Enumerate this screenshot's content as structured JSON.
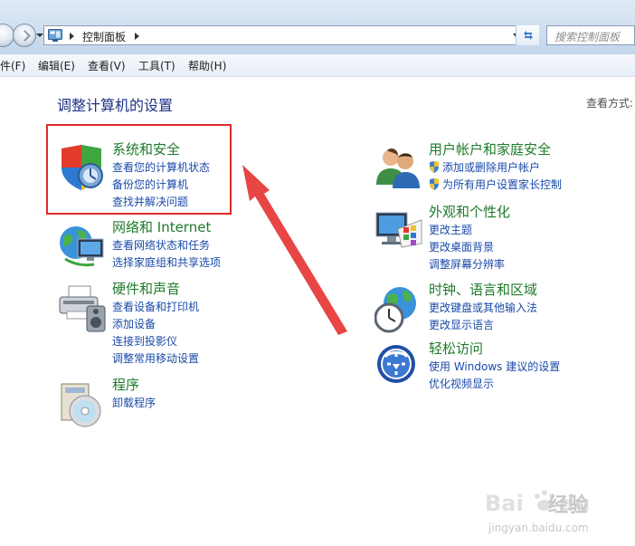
{
  "address": {
    "crumb": "控制面板",
    "search_placeholder": "搜索控制面板"
  },
  "menu": [
    "件(F)",
    "编辑(E)",
    "查看(V)",
    "工具(T)",
    "帮助(H)"
  ],
  "page_title": "调整计算机的设置",
  "view_by": "查看方式:",
  "categories": [
    {
      "title": "系统和安全",
      "links": [
        "查看您的计算机状态",
        "备份您的计算机",
        "查找并解决问题"
      ],
      "icon": "security-shield-icon"
    },
    {
      "title": "网络和 Internet",
      "links": [
        "查看网络状态和任务",
        "选择家庭组和共享选项"
      ],
      "icon": "network-globe-icon"
    },
    {
      "title": "硬件和声音",
      "links": [
        "查看设备和打印机",
        "添加设备",
        "连接到投影仪",
        "调整常用移动设置"
      ],
      "icon": "printer-icon"
    },
    {
      "title": "程序",
      "links": [
        "卸载程序"
      ],
      "icon": "programs-disc-icon"
    },
    {
      "title": "用户帐户和家庭安全",
      "links": [
        "添加或删除用户帐户",
        "为所有用户设置家长控制"
      ],
      "icon": "users-icon"
    },
    {
      "title": "外观和个性化",
      "links": [
        "更改主题",
        "更改桌面背景",
        "调整屏幕分辨率"
      ],
      "icon": "monitor-palette-icon"
    },
    {
      "title": "时钟、语言和区域",
      "links": [
        "更改键盘或其他输入法",
        "更改显示语言"
      ],
      "icon": "clock-globe-icon"
    },
    {
      "title": "轻松访问",
      "links": [
        "使用 Windows 建议的设置",
        "优化视频显示"
      ],
      "icon": "ease-of-access-icon"
    }
  ],
  "watermark": {
    "brand": "经验",
    "url": "jingyan.baidu.com"
  },
  "colors": {
    "title_green": "#1e7a2a",
    "link_blue": "#1a4aa8",
    "highlight_red": "#e02a2a"
  }
}
